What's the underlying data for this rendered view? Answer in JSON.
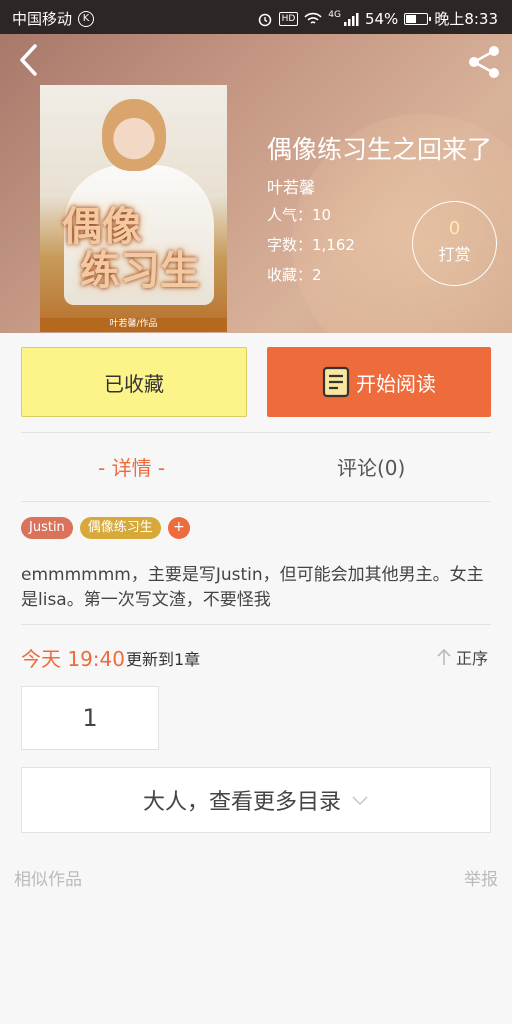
{
  "statusbar": {
    "carrier": "中国移动",
    "carrier_badge": "K",
    "hd": "HD",
    "network": "4G",
    "battery": "54%",
    "battery_level": 0.54,
    "time": "晚上8:33"
  },
  "book": {
    "title": "偶像练习生之回来了",
    "author": "叶若馨",
    "popularity": "人气：10",
    "words": "字数：1,162",
    "favorites": "收藏：2",
    "cover_title_line1": "偶像",
    "cover_title_line2": "练习生",
    "cover_author": "叶若馨/作品"
  },
  "tip": {
    "count": "0",
    "label": "打赏"
  },
  "actions": {
    "favorited_label": "已收藏",
    "read_label": "开始阅读"
  },
  "tabs": [
    {
      "label": "- 详情 -"
    },
    {
      "label": "评论(0)"
    }
  ],
  "tags": [
    "Justin",
    "偶像练习生"
  ],
  "tag_add": "+",
  "intro": "emmmmmm，主要是写Justin，但可能会加其他男主。女主是lisa。第一次写文渣，不要怪我",
  "update": {
    "time": "今天 19:40",
    "chapter_text": "更新到1章",
    "sort_label": "正序"
  },
  "chapters": [
    "1"
  ],
  "more_catalog": "大人，查看更多目录",
  "footer": {
    "similar": "相似作品",
    "report": "举报"
  },
  "colors": {
    "accent": "#ee6b3c",
    "favorite_bg": "#fdf489",
    "tag_a": "#d9735b",
    "tag_b": "#d6a93a"
  }
}
